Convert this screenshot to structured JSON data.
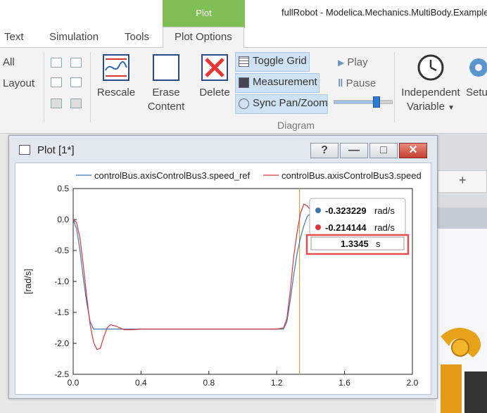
{
  "app": {
    "context_tab": "Plot",
    "window_title": "fullRobot - Modelica.Mechanics.MultiBody.Examples"
  },
  "tabs": [
    "Text",
    "Simulation",
    "Tools",
    "Plot Options"
  ],
  "ribbon": {
    "left_items": [
      "All",
      "Layout"
    ],
    "rescale": "Rescale",
    "erase_line1": "Erase",
    "erase_line2": "Content",
    "delete": "Delete",
    "toggle_grid": "Toggle Grid",
    "measurement": "Measurement",
    "sync": "Sync Pan/Zoom",
    "diagram_group": "Diagram",
    "play": "Play",
    "pause": "Pause",
    "independent_line1": "Independent",
    "independent_line2": "Variable",
    "setup": "Setu",
    "slider_level": 0.72
  },
  "plot_window": {
    "title": "Plot [1*]",
    "help": "?",
    "minimize": "—",
    "maximize": "□",
    "close": "✕"
  },
  "colors": {
    "ref": "#3c77b3",
    "speed": "#d9363e",
    "cursor": "#e0a03c",
    "highlight": "#e84b4b"
  },
  "chart_data": {
    "type": "line",
    "ylabel": "[rad/s]",
    "xlim": [
      0.0,
      2.0
    ],
    "ylim": [
      -2.5,
      0.5
    ],
    "xticks": [
      "0.0",
      "0.4",
      "0.8",
      "1.2",
      "1.6",
      "2.0"
    ],
    "yticks": [
      "0.5",
      "0.0",
      "-0.5",
      "-1.0",
      "-1.5",
      "-2.0",
      "-2.5"
    ],
    "grid": false,
    "legend": "top",
    "cursor_x": 1.3345,
    "series": [
      {
        "name": "controlBus.axisControlBus3.speed_ref",
        "x": [
          0,
          0.02,
          0.04,
          0.06,
          0.08,
          0.1,
          0.12,
          0.15,
          0.2,
          0.3,
          0.4,
          0.6,
          0.8,
          1.0,
          1.2,
          1.24,
          1.26,
          1.28,
          1.3,
          1.32,
          1.34,
          1.36,
          1.38,
          1.4,
          1.42,
          1.44
        ],
        "y": [
          0,
          -0.15,
          -0.5,
          -0.95,
          -1.35,
          -1.65,
          -1.77,
          -1.77,
          -1.77,
          -1.77,
          -1.77,
          -1.77,
          -1.77,
          -1.77,
          -1.77,
          -1.77,
          -1.65,
          -1.3,
          -0.9,
          -0.55,
          -0.3,
          -0.1,
          0.05,
          0.1,
          0.1,
          0.1
        ]
      },
      {
        "name": "controlBus.axisControlBus3.speed",
        "x": [
          0,
          0.02,
          0.04,
          0.06,
          0.08,
          0.1,
          0.12,
          0.14,
          0.16,
          0.18,
          0.2,
          0.22,
          0.25,
          0.3,
          0.35,
          0.4,
          0.6,
          0.8,
          1.0,
          1.2,
          1.24,
          1.26,
          1.28,
          1.3,
          1.32,
          1.34,
          1.36,
          1.38,
          1.4,
          1.42,
          1.44,
          1.46
        ],
        "y": [
          0,
          -0.05,
          -0.3,
          -0.75,
          -1.25,
          -1.7,
          -1.98,
          -2.1,
          -2.08,
          -1.9,
          -1.75,
          -1.7,
          -1.72,
          -1.78,
          -1.78,
          -1.77,
          -1.77,
          -1.77,
          -1.77,
          -1.77,
          -1.75,
          -1.6,
          -1.15,
          -0.6,
          -0.21,
          0.1,
          0.25,
          0.22,
          0.15,
          0.08,
          0.0,
          0.05
        ]
      }
    ],
    "tooltip": {
      "ref_value": "-0.323229",
      "speed_value": "-0.214144",
      "unit": "rad/s",
      "time_value": "1.3345",
      "time_unit": "s"
    }
  }
}
